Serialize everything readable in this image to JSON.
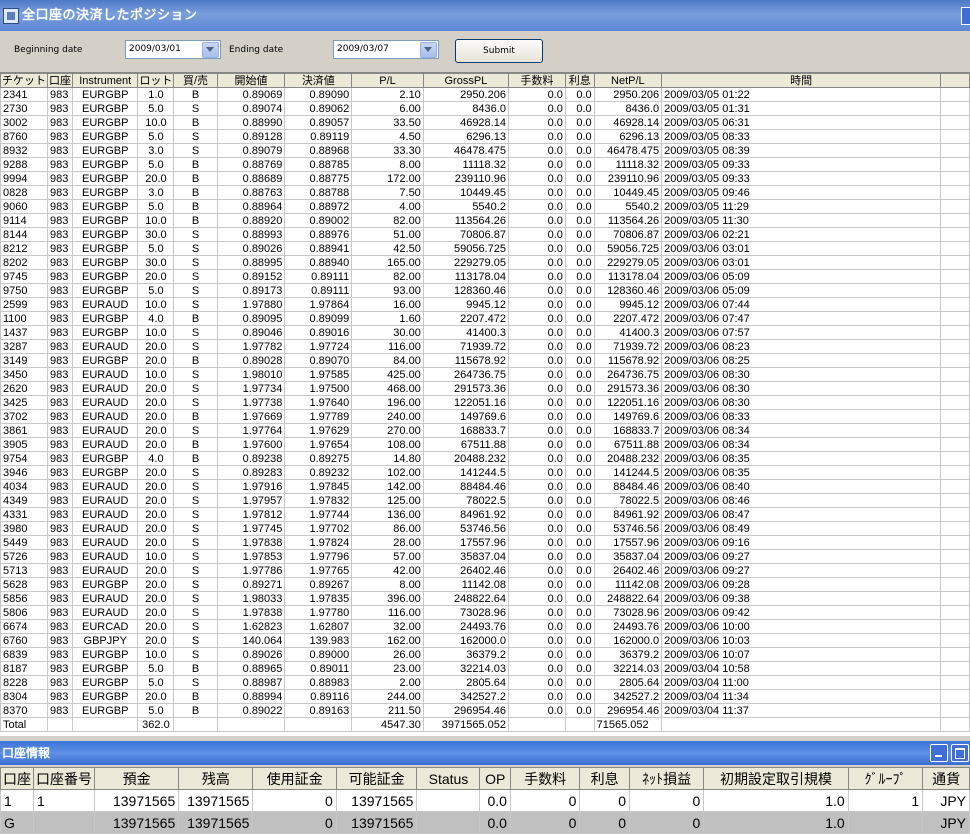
{
  "window": {
    "title": "全口座の決済したポジション"
  },
  "filter": {
    "beginning_label": "Beginning date",
    "beginning_value": "2009/03/01",
    "ending_label": "Ending date",
    "ending_value": "2009/03/07",
    "submit_label": "Submit"
  },
  "positions": {
    "columns": [
      "チケット",
      "口座",
      "Instrument",
      "ロット",
      "買/売",
      "開始値",
      "決済値",
      "P/L",
      "GrossPL",
      "手数料",
      "利息",
      "NetP/L",
      "時間"
    ],
    "rows": [
      [
        "2341",
        "983",
        "EURGBP",
        "1.0",
        "B",
        "0.89069",
        "0.89090",
        "2.10",
        "2950.206",
        "0.0",
        "0.0",
        "2950.206",
        "2009/03/05 01:22"
      ],
      [
        "2730",
        "983",
        "EURGBP",
        "5.0",
        "S",
        "0.89074",
        "0.89062",
        "6.00",
        "8436.0",
        "0.0",
        "0.0",
        "8436.0",
        "2009/03/05 01:31"
      ],
      [
        "3002",
        "983",
        "EURGBP",
        "10.0",
        "B",
        "0.88990",
        "0.89057",
        "33.50",
        "46928.14",
        "0.0",
        "0.0",
        "46928.14",
        "2009/03/05 06:31"
      ],
      [
        "8760",
        "983",
        "EURGBP",
        "5.0",
        "S",
        "0.89128",
        "0.89119",
        "4.50",
        "6296.13",
        "0.0",
        "0.0",
        "6296.13",
        "2009/03/05 08:33"
      ],
      [
        "8932",
        "983",
        "EURGBP",
        "3.0",
        "S",
        "0.89079",
        "0.88968",
        "33.30",
        "46478.475",
        "0.0",
        "0.0",
        "46478.475",
        "2009/03/05 08:39"
      ],
      [
        "9288",
        "983",
        "EURGBP",
        "5.0",
        "B",
        "0.88769",
        "0.88785",
        "8.00",
        "11118.32",
        "0.0",
        "0.0",
        "11118.32",
        "2009/03/05 09:33"
      ],
      [
        "9994",
        "983",
        "EURGBP",
        "20.0",
        "B",
        "0.88689",
        "0.88775",
        "172.00",
        "239110.96",
        "0.0",
        "0.0",
        "239110.96",
        "2009/03/05 09:33"
      ],
      [
        "0828",
        "983",
        "EURGBP",
        "3.0",
        "B",
        "0.88763",
        "0.88788",
        "7.50",
        "10449.45",
        "0.0",
        "0.0",
        "10449.45",
        "2009/03/05 09:46"
      ],
      [
        "9060",
        "983",
        "EURGBP",
        "5.0",
        "B",
        "0.88964",
        "0.88972",
        "4.00",
        "5540.2",
        "0.0",
        "0.0",
        "5540.2",
        "2009/03/05 11:29"
      ],
      [
        "9114",
        "983",
        "EURGBP",
        "10.0",
        "B",
        "0.88920",
        "0.89002",
        "82.00",
        "113564.26",
        "0.0",
        "0.0",
        "113564.26",
        "2009/03/05 11:30"
      ],
      [
        "8144",
        "983",
        "EURGBP",
        "30.0",
        "S",
        "0.88993",
        "0.88976",
        "51.00",
        "70806.87",
        "0.0",
        "0.0",
        "70806.87",
        "2009/03/06 02:21"
      ],
      [
        "8212",
        "983",
        "EURGBP",
        "5.0",
        "S",
        "0.89026",
        "0.88941",
        "42.50",
        "59056.725",
        "0.0",
        "0.0",
        "59056.725",
        "2009/03/06 03:01"
      ],
      [
        "8202",
        "983",
        "EURGBP",
        "30.0",
        "S",
        "0.88995",
        "0.88940",
        "165.00",
        "229279.05",
        "0.0",
        "0.0",
        "229279.05",
        "2009/03/06 03:01"
      ],
      [
        "9745",
        "983",
        "EURGBP",
        "20.0",
        "S",
        "0.89152",
        "0.89111",
        "82.00",
        "113178.04",
        "0.0",
        "0.0",
        "113178.04",
        "2009/03/06 05:09"
      ],
      [
        "9750",
        "983",
        "EURGBP",
        "5.0",
        "S",
        "0.89173",
        "0.89111",
        "93.00",
        "128360.46",
        "0.0",
        "0.0",
        "128360.46",
        "2009/03/06 05:09"
      ],
      [
        "2599",
        "983",
        "EURAUD",
        "10.0",
        "S",
        "1.97880",
        "1.97864",
        "16.00",
        "9945.12",
        "0.0",
        "0.0",
        "9945.12",
        "2009/03/06 07:44"
      ],
      [
        "1100",
        "983",
        "EURGBP",
        "4.0",
        "B",
        "0.89095",
        "0.89099",
        "1.60",
        "2207.472",
        "0.0",
        "0.0",
        "2207.472",
        "2009/03/06 07:47"
      ],
      [
        "1437",
        "983",
        "EURGBP",
        "10.0",
        "S",
        "0.89046",
        "0.89016",
        "30.00",
        "41400.3",
        "0.0",
        "0.0",
        "41400.3",
        "2009/03/06 07:57"
      ],
      [
        "3287",
        "983",
        "EURAUD",
        "20.0",
        "S",
        "1.97782",
        "1.97724",
        "116.00",
        "71939.72",
        "0.0",
        "0.0",
        "71939.72",
        "2009/03/06 08:23"
      ],
      [
        "3149",
        "983",
        "EURGBP",
        "20.0",
        "B",
        "0.89028",
        "0.89070",
        "84.00",
        "115678.92",
        "0.0",
        "0.0",
        "115678.92",
        "2009/03/06 08:25"
      ],
      [
        "3450",
        "983",
        "EURAUD",
        "10.0",
        "S",
        "1.98010",
        "1.97585",
        "425.00",
        "264736.75",
        "0.0",
        "0.0",
        "264736.75",
        "2009/03/06 08:30"
      ],
      [
        "2620",
        "983",
        "EURAUD",
        "20.0",
        "S",
        "1.97734",
        "1.97500",
        "468.00",
        "291573.36",
        "0.0",
        "0.0",
        "291573.36",
        "2009/03/06 08:30"
      ],
      [
        "3425",
        "983",
        "EURAUD",
        "20.0",
        "S",
        "1.97738",
        "1.97640",
        "196.00",
        "122051.16",
        "0.0",
        "0.0",
        "122051.16",
        "2009/03/06 08:30"
      ],
      [
        "3702",
        "983",
        "EURAUD",
        "20.0",
        "B",
        "1.97669",
        "1.97789",
        "240.00",
        "149769.6",
        "0.0",
        "0.0",
        "149769.6",
        "2009/03/06 08:33"
      ],
      [
        "3861",
        "983",
        "EURAUD",
        "20.0",
        "S",
        "1.97764",
        "1.97629",
        "270.00",
        "168833.7",
        "0.0",
        "0.0",
        "168833.7",
        "2009/03/06 08:34"
      ],
      [
        "3905",
        "983",
        "EURAUD",
        "20.0",
        "B",
        "1.97600",
        "1.97654",
        "108.00",
        "67511.88",
        "0.0",
        "0.0",
        "67511.88",
        "2009/03/06 08:34"
      ],
      [
        "9754",
        "983",
        "EURGBP",
        "4.0",
        "B",
        "0.89238",
        "0.89275",
        "14.80",
        "20488.232",
        "0.0",
        "0.0",
        "20488.232",
        "2009/03/06 08:35"
      ],
      [
        "3946",
        "983",
        "EURGBP",
        "20.0",
        "S",
        "0.89283",
        "0.89232",
        "102.00",
        "141244.5",
        "0.0",
        "0.0",
        "141244.5",
        "2009/03/06 08:35"
      ],
      [
        "4034",
        "983",
        "EURAUD",
        "20.0",
        "S",
        "1.97916",
        "1.97845",
        "142.00",
        "88484.46",
        "0.0",
        "0.0",
        "88484.46",
        "2009/03/06 08:40"
      ],
      [
        "4349",
        "983",
        "EURAUD",
        "20.0",
        "S",
        "1.97957",
        "1.97832",
        "125.00",
        "78022.5",
        "0.0",
        "0.0",
        "78022.5",
        "2009/03/06 08:46"
      ],
      [
        "4331",
        "983",
        "EURAUD",
        "20.0",
        "S",
        "1.97812",
        "1.97744",
        "136.00",
        "84961.92",
        "0.0",
        "0.0",
        "84961.92",
        "2009/03/06 08:47"
      ],
      [
        "3980",
        "983",
        "EURAUD",
        "20.0",
        "S",
        "1.97745",
        "1.97702",
        "86.00",
        "53746.56",
        "0.0",
        "0.0",
        "53746.56",
        "2009/03/06 08:49"
      ],
      [
        "5449",
        "983",
        "EURAUD",
        "20.0",
        "S",
        "1.97838",
        "1.97824",
        "28.00",
        "17557.96",
        "0.0",
        "0.0",
        "17557.96",
        "2009/03/06 09:16"
      ],
      [
        "5726",
        "983",
        "EURAUD",
        "10.0",
        "S",
        "1.97853",
        "1.97796",
        "57.00",
        "35837.04",
        "0.0",
        "0.0",
        "35837.04",
        "2009/03/06 09:27"
      ],
      [
        "5713",
        "983",
        "EURAUD",
        "20.0",
        "S",
        "1.97786",
        "1.97765",
        "42.00",
        "26402.46",
        "0.0",
        "0.0",
        "26402.46",
        "2009/03/06 09:27"
      ],
      [
        "5628",
        "983",
        "EURGBP",
        "20.0",
        "S",
        "0.89271",
        "0.89267",
        "8.00",
        "11142.08",
        "0.0",
        "0.0",
        "11142.08",
        "2009/03/06 09:28"
      ],
      [
        "5856",
        "983",
        "EURAUD",
        "20.0",
        "S",
        "1.98033",
        "1.97835",
        "396.00",
        "248822.64",
        "0.0",
        "0.0",
        "248822.64",
        "2009/03/06 09:38"
      ],
      [
        "5806",
        "983",
        "EURAUD",
        "20.0",
        "S",
        "1.97838",
        "1.97780",
        "116.00",
        "73028.96",
        "0.0",
        "0.0",
        "73028.96",
        "2009/03/06 09:42"
      ],
      [
        "6674",
        "983",
        "EURCAD",
        "20.0",
        "S",
        "1.62823",
        "1.62807",
        "32.00",
        "24493.76",
        "0.0",
        "0.0",
        "24493.76",
        "2009/03/06 10:00"
      ],
      [
        "6760",
        "983",
        "GBPJPY",
        "20.0",
        "S",
        "140.064",
        "139.983",
        "162.00",
        "162000.0",
        "0.0",
        "0.0",
        "162000.0",
        "2009/03/06 10:03"
      ],
      [
        "6839",
        "983",
        "EURGBP",
        "10.0",
        "S",
        "0.89026",
        "0.89000",
        "26.00",
        "36379.2",
        "0.0",
        "0.0",
        "36379.2",
        "2009/03/06 10:07"
      ],
      [
        "8187",
        "983",
        "EURGBP",
        "5.0",
        "B",
        "0.88965",
        "0.89011",
        "23.00",
        "32214.03",
        "0.0",
        "0.0",
        "32214.03",
        "2009/03/04 10:58"
      ],
      [
        "8228",
        "983",
        "EURGBP",
        "5.0",
        "S",
        "0.88987",
        "0.88983",
        "2.00",
        "2805.64",
        "0.0",
        "0.0",
        "2805.64",
        "2009/03/04 11:00"
      ],
      [
        "8304",
        "983",
        "EURGBP",
        "20.0",
        "B",
        "0.88994",
        "0.89116",
        "244.00",
        "342527.2",
        "0.0",
        "0.0",
        "342527.2",
        "2009/03/04 11:34"
      ],
      [
        "8370",
        "983",
        "EURGBP",
        "5.0",
        "B",
        "0.89022",
        "0.89163",
        "211.50",
        "296954.46",
        "0.0",
        "0.0",
        "296954.46",
        "2009/03/04 11:37"
      ]
    ],
    "total": {
      "label": "Total",
      "lots": "362.0",
      "pl": "4547.30",
      "gross": "3971565.052",
      "net": "71565.052"
    }
  },
  "account_panel": {
    "title": "口座情報",
    "columns": [
      "口座",
      "口座番号",
      "預金",
      "残高",
      "使用証金",
      "可能証金",
      "Status",
      "OP",
      "手数料",
      "利息",
      "ﾈｯﾄ損益",
      "初期設定取引規模",
      "ｸﾞﾙｰﾌﾟ",
      "通貨"
    ],
    "rows": [
      [
        "1",
        "1",
        "13971565",
        "13971565",
        "0",
        "13971565",
        "",
        "0.0",
        "0",
        "0",
        "0",
        "1.0",
        "1",
        "JPY"
      ],
      [
        "G",
        "",
        "13971565",
        "13971565",
        "0",
        "13971565",
        "",
        "0.0",
        "0",
        "0",
        "0",
        "1.0",
        "",
        "JPY"
      ]
    ]
  },
  "colors": {
    "title_bar": "#5c86d4",
    "grid_header": "#ece9d8",
    "selected_row": "#c0c0c0"
  }
}
